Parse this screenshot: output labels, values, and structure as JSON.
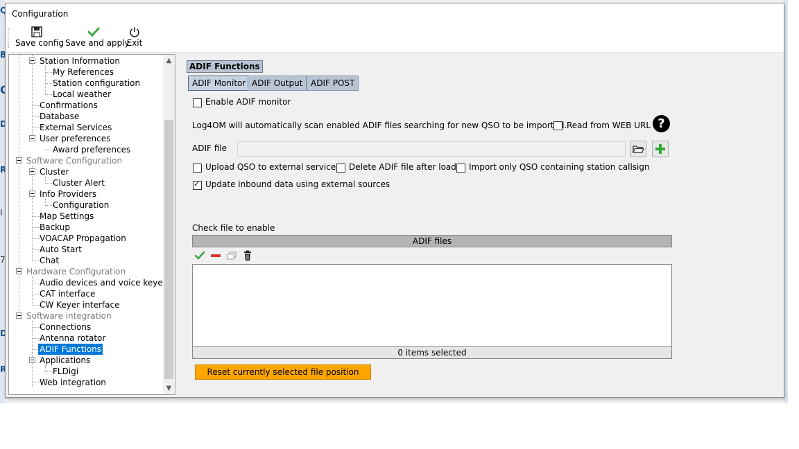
{
  "window": {
    "title": "Configuration"
  },
  "toolbar": {
    "save_config": {
      "label": "Save config",
      "icon": "floppy-disk-icon"
    },
    "save_apply": {
      "label": "Save and apply",
      "icon": "green-check-icon"
    },
    "exit": {
      "label": "Exit",
      "icon": "power-icon"
    }
  },
  "tree": {
    "station_information": "Station Information",
    "my_references": "My References",
    "station_configuration": "Station configuration",
    "local_weather": "Local weather",
    "confirmations": "Confirmations",
    "database": "Database",
    "external_services": "External Services",
    "user_preferences": "User preferences",
    "award_preferences": "Award preferences",
    "software_configuration": "Software Configuration",
    "cluster": "Cluster",
    "cluster_alert": "Cluster Alert",
    "info_providers": "Info Providers",
    "info_configuration": "Configuration",
    "map_settings": "Map Settings",
    "backup": "Backup",
    "voacap": "VOACAP Propagation",
    "auto_start": "Auto Start",
    "chat": "Chat",
    "hardware_configuration": "Hardware Configuration",
    "audio_devices": "Audio devices and voice keyer",
    "cat_interface": "CAT interface",
    "cw_keyer": "CW Keyer interface",
    "software_integration": "Software integration",
    "connections": "Connections",
    "antenna_rotator": "Antenna rotator",
    "adif_functions": "ADIF Functions",
    "applications": "Applications",
    "fldigi": "FLDigi",
    "web_integration": "Web integration"
  },
  "main": {
    "section_title": "ADIF Functions",
    "tabs": {
      "monitor": "ADIF Monitor",
      "output": "ADIF Output",
      "post": "ADIF POST"
    },
    "enable_monitor": {
      "label": "Enable ADIF monitor",
      "checked": false
    },
    "description": "Log4OM will automatically scan enabled ADIF files searching for new QSO to be imported.",
    "read_from_web": {
      "label": "Read from WEB URL",
      "checked": false
    },
    "adif_file_label": "ADIF file",
    "adif_file_value": "",
    "upload_qso": {
      "label": "Upload QSO to external services",
      "checked": false
    },
    "delete_after_load": {
      "label": "Delete ADIF file after load",
      "checked": false
    },
    "import_only_station": {
      "label": "Import only QSO containing station callsign",
      "checked": false
    },
    "update_inbound": {
      "label": "Update inbound data using external sources",
      "checked": true
    },
    "check_file_label": "Check file to enable",
    "files_header": "ADIF files",
    "files_status": "0 items selected",
    "reset_button": "Reset currently selected file position"
  },
  "background_letters": [
    "Q",
    "B",
    "C",
    "D",
    "R",
    "I",
    "7",
    "D",
    "R"
  ],
  "colors": {
    "section_header_bg": "#b9c4d3",
    "selection": "#0078d7",
    "reset_button": "#ffa500",
    "files_header_bg": "#b4b4b4"
  }
}
